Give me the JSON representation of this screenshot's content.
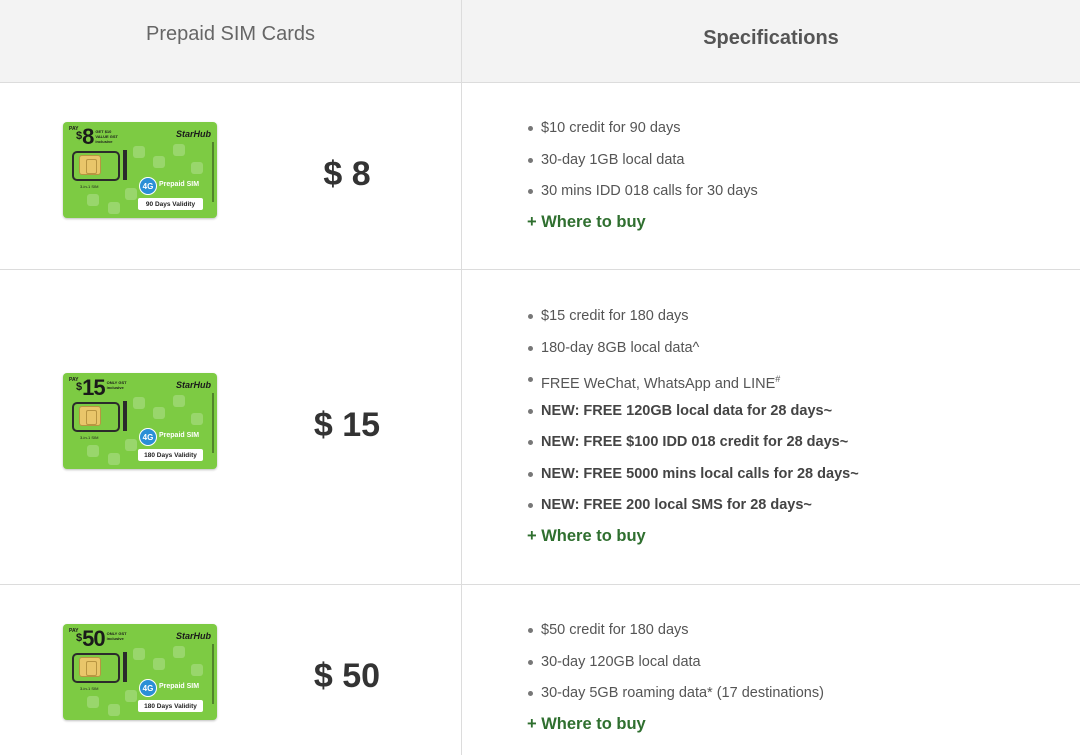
{
  "header": {
    "left_title": "Prepaid SIM Cards",
    "right_title": "Specifications"
  },
  "colors": {
    "link": "#2f6f2f",
    "card_green": "#7dcb43",
    "header_bg": "#f3f3f3"
  },
  "rows": [
    {
      "price": "$ 8",
      "card": {
        "pay": "PAY",
        "currency": "$",
        "amount": "8",
        "promo": "GET $10 VALUE GST inclusive",
        "brand": "StarHub",
        "tech": "4G",
        "type": "Prepaid SIM",
        "validity": "90 Days Validity",
        "sizes": "3-in-1 SIM"
      },
      "specs": [
        {
          "text": "$10 credit for 90 days",
          "bold": false
        },
        {
          "text": "30-day 1GB local data",
          "bold": false
        },
        {
          "text": "30 mins IDD 018 calls for 30 days",
          "bold": false
        }
      ],
      "buy_label": "+ Where to buy"
    },
    {
      "price": "$ 15",
      "card": {
        "pay": "PAY",
        "currency": "$",
        "amount": "15",
        "promo": "ONLY GST inclusive",
        "brand": "StarHub",
        "tech": "4G",
        "type": "Prepaid SIM",
        "validity": "180 Days Validity",
        "sizes": "3-in-1 SIM"
      },
      "specs": [
        {
          "text": "$15 credit for 180 days",
          "bold": false
        },
        {
          "text": "180-day 8GB local data^",
          "bold": false
        },
        {
          "text": "FREE WeChat, WhatsApp and LINE",
          "sup": "#",
          "bold": false
        },
        {
          "text": "NEW: FREE 120GB local data for 28 days~",
          "bold": true
        },
        {
          "text": "NEW: FREE $100 IDD 018 credit for 28 days~",
          "bold": true
        },
        {
          "text": "NEW: FREE 5000 mins local calls for 28 days~",
          "bold": true
        },
        {
          "text": "NEW: FREE 200 local SMS for 28 days~",
          "bold": true
        }
      ],
      "buy_label": "+ Where to buy"
    },
    {
      "price": "$ 50",
      "card": {
        "pay": "PAY",
        "currency": "$",
        "amount": "50",
        "promo": "ONLY GST inclusive",
        "brand": "StarHub",
        "tech": "4G",
        "type": "Prepaid SIM",
        "validity": "180 Days Validity",
        "sizes": "3-in-1 SIM"
      },
      "specs": [
        {
          "text": "$50 credit for 180 days",
          "bold": false
        },
        {
          "text": "30-day 120GB local data",
          "bold": false
        },
        {
          "text": "30-day 5GB roaming data* (17 destinations)",
          "bold": false
        }
      ],
      "buy_label": "+ Where to buy"
    }
  ]
}
